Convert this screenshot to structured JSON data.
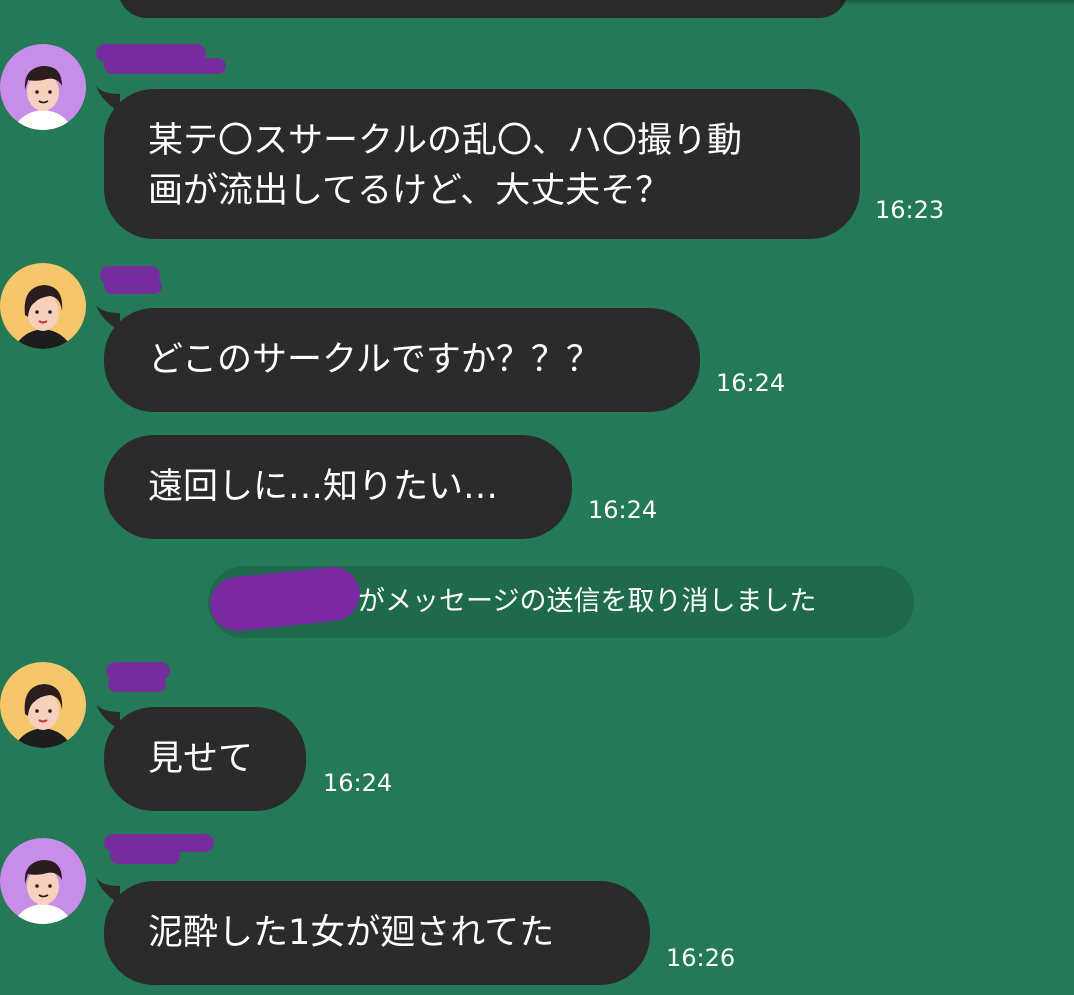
{
  "messages": [
    {
      "text": "某テ〇スサークルの乱〇、ハ〇撮り動\n画が流出してるけど、大丈夫そ？",
      "time": "16:23"
    },
    {
      "text": "どこのサークルですか？？？",
      "time": "16:24"
    },
    {
      "text": "遠回しに…知りたい…",
      "time": "16:24"
    },
    {
      "text": "見せて",
      "time": "16:24"
    },
    {
      "text": "泥酔した1女が廻されてた",
      "time": "16:26"
    }
  ],
  "system_notice": {
    "text": "がメッセージの送信を取り消しました"
  },
  "colors": {
    "background": "#247a57",
    "bubble": "#2b2b2b",
    "redaction": "#7b2aa3",
    "avatar_purple": "#c78de8",
    "avatar_yellow": "#f6c66a"
  },
  "icons": {
    "avatar_a": "man-avatar-icon",
    "avatar_b": "woman-avatar-icon"
  }
}
